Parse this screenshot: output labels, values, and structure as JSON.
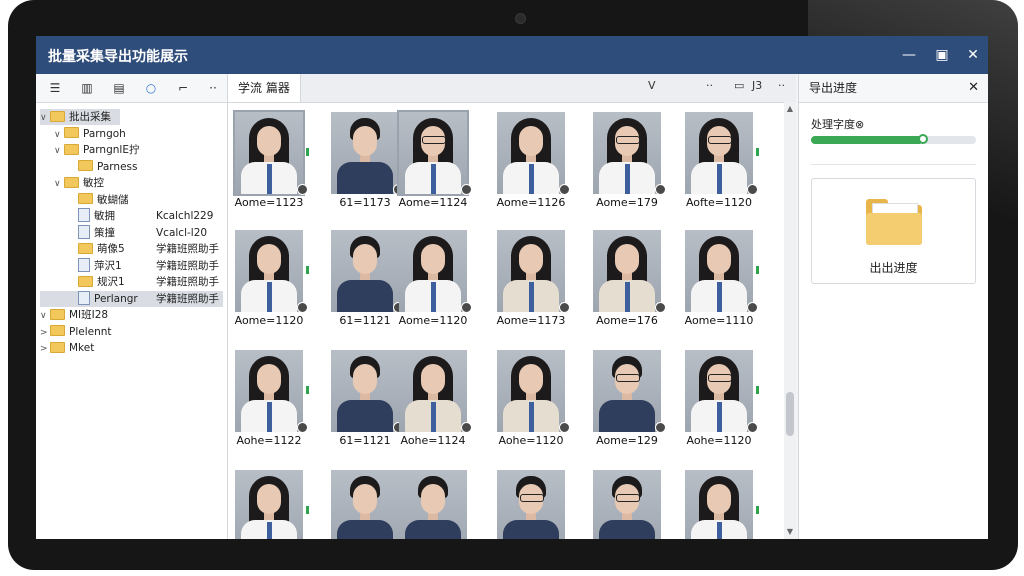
{
  "window": {
    "title": "批量采集导出功能展示",
    "buttons": {
      "minimize": "—",
      "maximize": "▣",
      "close": "✕"
    }
  },
  "left_toolbar": {
    "icons": [
      "list-icon",
      "columns-icon",
      "document-icon",
      "circle-icon",
      "flag-icon",
      "more-icon"
    ],
    "more_label": "··"
  },
  "tree": {
    "items": [
      {
        "label": "批出采集",
        "col2": "",
        "caret": "∨",
        "kind": "folder",
        "level": 0,
        "selected": true
      },
      {
        "label": "Parngoh",
        "col2": "",
        "caret": "∨",
        "kind": "folder",
        "level": 1
      },
      {
        "label": "ParngnlE拧",
        "col2": "",
        "caret": "∨",
        "kind": "folder",
        "level": 1
      },
      {
        "label": "Parness",
        "col2": "",
        "caret": "",
        "kind": "folder",
        "level": 2
      },
      {
        "label": "敏控",
        "col2": "",
        "caret": "∨",
        "kind": "folder",
        "level": 1
      },
      {
        "label": "敏蝴儲",
        "col2": "",
        "caret": "",
        "kind": "folder",
        "level": 2
      },
      {
        "label": "敏拥",
        "col2": "Kcalchl229",
        "caret": "",
        "kind": "doc",
        "level": 2
      },
      {
        "label": "策撞",
        "col2": "Vcalcl-l20",
        "caret": "",
        "kind": "doc",
        "level": 2
      },
      {
        "label": "萌像5",
        "col2": "学籍班照助手",
        "caret": "",
        "kind": "folder",
        "level": 2
      },
      {
        "label": "萍沢1",
        "col2": "学籍班照助手",
        "caret": "",
        "kind": "doc",
        "level": 2
      },
      {
        "label": "规沢1",
        "col2": "学籍班照助手",
        "caret": "",
        "kind": "folder",
        "level": 2
      },
      {
        "label": "Perlangr",
        "col2": "学籍班照助手",
        "caret": "",
        "kind": "doc",
        "level": 2,
        "highlight": true
      },
      {
        "label": "MI班I28",
        "col2": "",
        "caret": "∨",
        "kind": "folder",
        "level": 0
      },
      {
        "label": "Plelennt",
        "col2": "",
        "caret": ">",
        "kind": "folder",
        "level": 0
      },
      {
        "label": "Mket",
        "col2": "",
        "caret": ">",
        "kind": "folder",
        "level": 0
      }
    ]
  },
  "center": {
    "tab_label": "学流 篇器",
    "tab_controls": [
      "V",
      "··",
      "▭",
      "J3",
      "··"
    ],
    "cards": [
      {
        "label": "Aome=1123",
        "type": "female",
        "selected": true
      },
      {
        "label": "61=1173",
        "type": "male"
      },
      {
        "label": "Aome=1124",
        "type": "female-glasses",
        "selected": true
      },
      {
        "label": "Aome=1126",
        "type": "female"
      },
      {
        "label": "Aome=179",
        "type": "female-glasses"
      },
      {
        "label": "Aofte=1120",
        "type": "female-glasses"
      },
      {
        "label": "Aome=1120",
        "type": "female"
      },
      {
        "label": "61=1121",
        "type": "male"
      },
      {
        "label": "Aome=1120",
        "type": "female"
      },
      {
        "label": "Aome=1173",
        "type": "female-beige"
      },
      {
        "label": "Aome=176",
        "type": "female-beige"
      },
      {
        "label": "Aome=1110",
        "type": "female"
      },
      {
        "label": "Aohe=1122",
        "type": "female"
      },
      {
        "label": "61=1121",
        "type": "male"
      },
      {
        "label": "Aohe=1124",
        "type": "female-beige"
      },
      {
        "label": "Aohe=1120",
        "type": "female-beige"
      },
      {
        "label": "Aome=129",
        "type": "male-glasses"
      },
      {
        "label": "Aohe=1120",
        "type": "female-glasses"
      },
      {
        "label": "",
        "type": "female"
      },
      {
        "label": "",
        "type": "male"
      },
      {
        "label": "",
        "type": "male"
      },
      {
        "label": "",
        "type": "male-glasses"
      },
      {
        "label": "",
        "type": "male-glasses"
      },
      {
        "label": "",
        "type": "female"
      }
    ]
  },
  "right_panel": {
    "title": "导出进度",
    "close": "✕",
    "progress_label": "处理字度⊗",
    "progress_fraction": 0.68,
    "export_caption": "出出进度"
  }
}
